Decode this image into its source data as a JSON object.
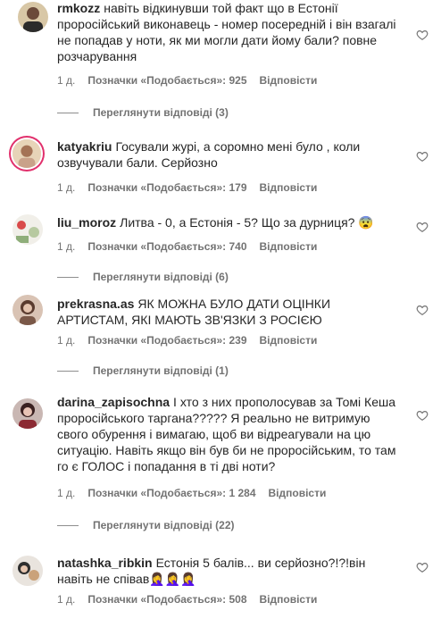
{
  "comments": [
    {
      "username": "rmkozz",
      "text": "навіть відкинувши той факт що в Естонії проросійський виконавець - номер посередній і він взагалі не попадав у ноти, як ми могли дати йому бали? повне розчарування",
      "time": "1 д.",
      "likes": "Позначки «Подобається»: 925",
      "reply": "Відповісти",
      "view_replies": "Переглянути відповіді (3)"
    },
    {
      "username": "katyakriu",
      "text": "Госували журі, а соромно мені було , коли озвучували бали. Серйозно",
      "time": "1 д.",
      "likes": "Позначки «Подобається»: 179",
      "reply": "Відповісти"
    },
    {
      "username": "liu_moroz",
      "text": "Литва - 0, а Естонія - 5? Що за дурниця? 😨",
      "time": "1 д.",
      "likes": "Позначки «Подобається»: 740",
      "reply": "Відповісти",
      "view_replies": "Переглянути відповіді (6)"
    },
    {
      "username": "prekrasna.as",
      "text": "ЯК МОЖНА БУЛО ДАТИ ОЦІНКИ АРТИСТАМ, ЯКІ МАЮТЬ ЗВ'ЯЗКИ З РОСІЄЮ",
      "time": "1 д.",
      "likes": "Позначки «Подобається»: 239",
      "reply": "Відповісти",
      "view_replies": "Переглянути відповіді (1)"
    },
    {
      "username": "darina_zapisochna",
      "text": "І хто з них прополосував за Томі Кеша проросійського таргана????? Я реально не витримую свого обурення і вимагаю, щоб ви відреагували на цю ситуацію. Навіть якщо він був би не проросійським, то там го є ГОЛОС і попадання в ті дві ноти?",
      "time": "1 д.",
      "likes": "Позначки «Подобається»: 1 284",
      "reply": "Відповісти",
      "view_replies": "Переглянути відповіді (22)"
    },
    {
      "username": "natashka_ribkin",
      "text": "Естонія 5 балів... ви серйозно?!?!він навіть не співав🤦‍♀️🤦‍♀️🤦‍♀️",
      "time": "1 д.",
      "likes": "Позначки «Подобається»: 508",
      "reply": "Відповісти"
    }
  ],
  "icons": {
    "like": "heart-outline-icon"
  },
  "colors": {
    "text": "#262626",
    "secondary": "#737373",
    "story_ring": "#e1306c"
  }
}
